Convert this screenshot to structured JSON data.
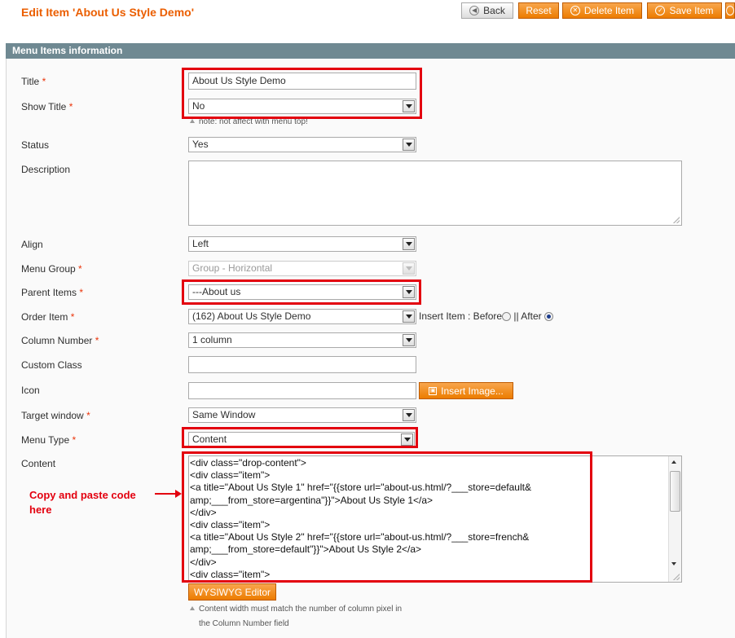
{
  "header": {
    "title": "Edit Item 'About Us Style Demo'",
    "buttons": {
      "back": "Back",
      "reset": "Reset",
      "delete": "Delete Item",
      "save": "Save Item"
    }
  },
  "section": {
    "title": "Menu Items information"
  },
  "fields": {
    "title": {
      "label": "Title",
      "value": "About Us Style Demo"
    },
    "show_title": {
      "label": "Show Title",
      "value": "No",
      "note": "note: not affect with menu top!"
    },
    "status": {
      "label": "Status",
      "value": "Yes"
    },
    "description": {
      "label": "Description",
      "value": ""
    },
    "align": {
      "label": "Align",
      "value": "Left"
    },
    "menu_group": {
      "label": "Menu Group",
      "value": "Group - Horizontal"
    },
    "parent_items": {
      "label": "Parent Items",
      "value": "---About us"
    },
    "order_item": {
      "label": "Order Item",
      "value": "(162) About Us Style Demo",
      "insert_label": "Insert Item : Before",
      "after_label": "|| After",
      "selected": "After"
    },
    "column_number": {
      "label": "Column Number",
      "value": "1 column"
    },
    "custom_class": {
      "label": "Custom Class",
      "value": ""
    },
    "icon": {
      "label": "Icon",
      "value": "",
      "insert_button": "Insert Image..."
    },
    "target_window": {
      "label": "Target window",
      "value": "Same Window"
    },
    "menu_type": {
      "label": "Menu Type",
      "value": "Content"
    },
    "content": {
      "label": "Content",
      "lines": [
        "<div class=\"drop-content\">",
        "<div class=\"item\">",
        "<a title=\"About Us Style 1\" href=\"{{store url=\"about-us.html/?___store=default&",
        "amp;___from_store=argentina\"}}\">About Us Style 1</a>",
        "</div>",
        "<div class=\"item\">",
        "<a title=\"About Us Style 2\" href=\"{{store url=\"about-us.html/?___store=french&",
        "amp;___from_store=default\"}}\">About Us Style 2</a>",
        "</div>",
        "<div class=\"item\">"
      ],
      "wysiwyg_button": "WYSIWYG Editor",
      "note_line1": "Content width must match the number of column pixel in",
      "note_line2": "the Column Number field"
    }
  },
  "annotation": {
    "line1": "Copy and paste code",
    "line2": "here"
  },
  "colors": {
    "accent": "#eb5e00",
    "section_header": "#6f8992",
    "highlight": "#e3000f"
  }
}
